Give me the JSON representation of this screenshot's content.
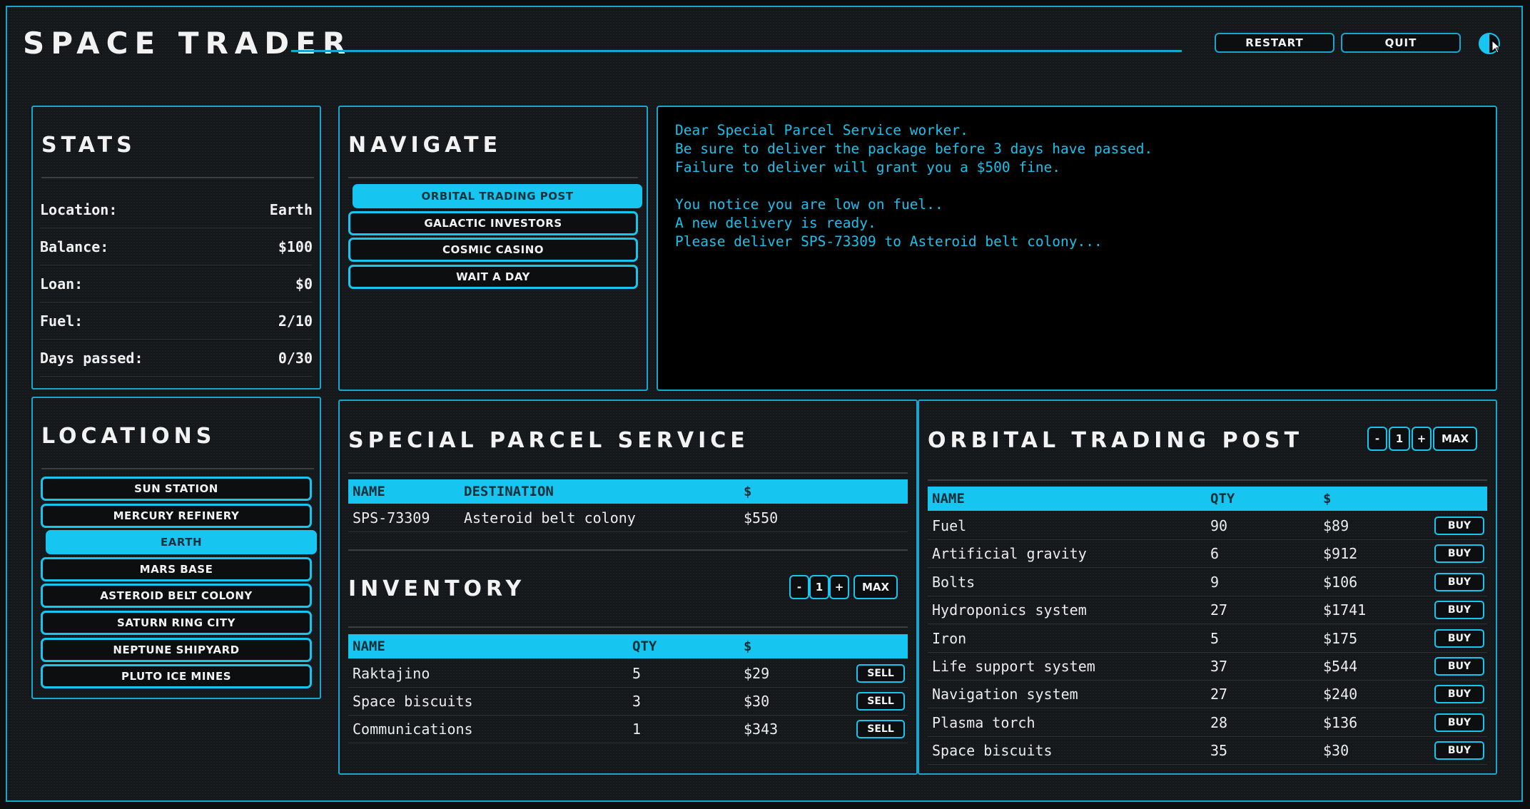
{
  "app": {
    "title": "SPACE TRADER"
  },
  "header": {
    "restart_label": "RESTART",
    "quit_label": "QUIT"
  },
  "stats": {
    "title": "STATS",
    "rows": [
      {
        "label": "Location:",
        "value": "Earth"
      },
      {
        "label": "Balance:",
        "value": "$100"
      },
      {
        "label": "Loan:",
        "value": "$0"
      },
      {
        "label": "Fuel:",
        "value": "2/10"
      },
      {
        "label": "Days passed:",
        "value": "0/30"
      }
    ]
  },
  "navigate": {
    "title": "NAVIGATE",
    "items": [
      "ORBITAL TRADING POST",
      "GALACTIC INVESTORS",
      "COSMIC CASINO",
      "WAIT A DAY"
    ],
    "active_index": 0
  },
  "console": {
    "lines": [
      "Dear Special Parcel Service worker.",
      "Be sure to deliver the package before 3 days have passed.",
      "Failure to deliver will grant you a $500 fine.",
      "",
      "You notice you are low on fuel..",
      "A new delivery is ready.",
      "Please deliver SPS-73309 to Asteroid belt colony..."
    ]
  },
  "locations": {
    "title": "LOCATIONS",
    "items": [
      "SUN STATION",
      "MERCURY REFINERY",
      "EARTH",
      "MARS BASE",
      "ASTEROID BELT COLONY",
      "SATURN RING CITY",
      "NEPTUNE SHIPYARD",
      "PLUTO ICE MINES"
    ],
    "active_index": 2
  },
  "parcel": {
    "title": "SPECIAL PARCEL SERVICE",
    "headers": {
      "name": "NAME",
      "destination": "DESTINATION",
      "price": "$"
    },
    "rows": [
      {
        "name": "SPS-73309",
        "destination": "Asteroid belt colony",
        "price": "$550"
      }
    ]
  },
  "inventory": {
    "title": "INVENTORY",
    "qty": {
      "minus": "-",
      "value": "1",
      "plus": "+",
      "max": "MAX"
    },
    "headers": {
      "name": "NAME",
      "qty": "QTY",
      "price": "$"
    },
    "sell_label": "SELL",
    "rows": [
      {
        "name": "Raktajino",
        "qty": "5",
        "price": "$29"
      },
      {
        "name": "Space biscuits",
        "qty": "3",
        "price": "$30"
      },
      {
        "name": "Communications",
        "qty": "1",
        "price": "$343"
      }
    ]
  },
  "market": {
    "title": "ORBITAL TRADING POST",
    "qty": {
      "minus": "-",
      "value": "1",
      "plus": "+",
      "max": "MAX"
    },
    "headers": {
      "name": "NAME",
      "qty": "QTY",
      "price": "$"
    },
    "buy_label": "BUY",
    "rows": [
      {
        "name": "Fuel",
        "qty": "90",
        "price": "$89"
      },
      {
        "name": "Artificial gravity",
        "qty": "6",
        "price": "$912"
      },
      {
        "name": "Bolts",
        "qty": "9",
        "price": "$106"
      },
      {
        "name": "Hydroponics system",
        "qty": "27",
        "price": "$1741"
      },
      {
        "name": "Iron",
        "qty": "5",
        "price": "$175"
      },
      {
        "name": "Life support system",
        "qty": "37",
        "price": "$544"
      },
      {
        "name": "Navigation system",
        "qty": "27",
        "price": "$240"
      },
      {
        "name": "Plasma torch",
        "qty": "28",
        "price": "$136"
      },
      {
        "name": "Space biscuits",
        "qty": "35",
        "price": "$30"
      }
    ]
  },
  "colors": {
    "accent": "#16c6f0",
    "border": "#16a7cf",
    "background": "#15181b",
    "console_text": "#19c2ec"
  }
}
